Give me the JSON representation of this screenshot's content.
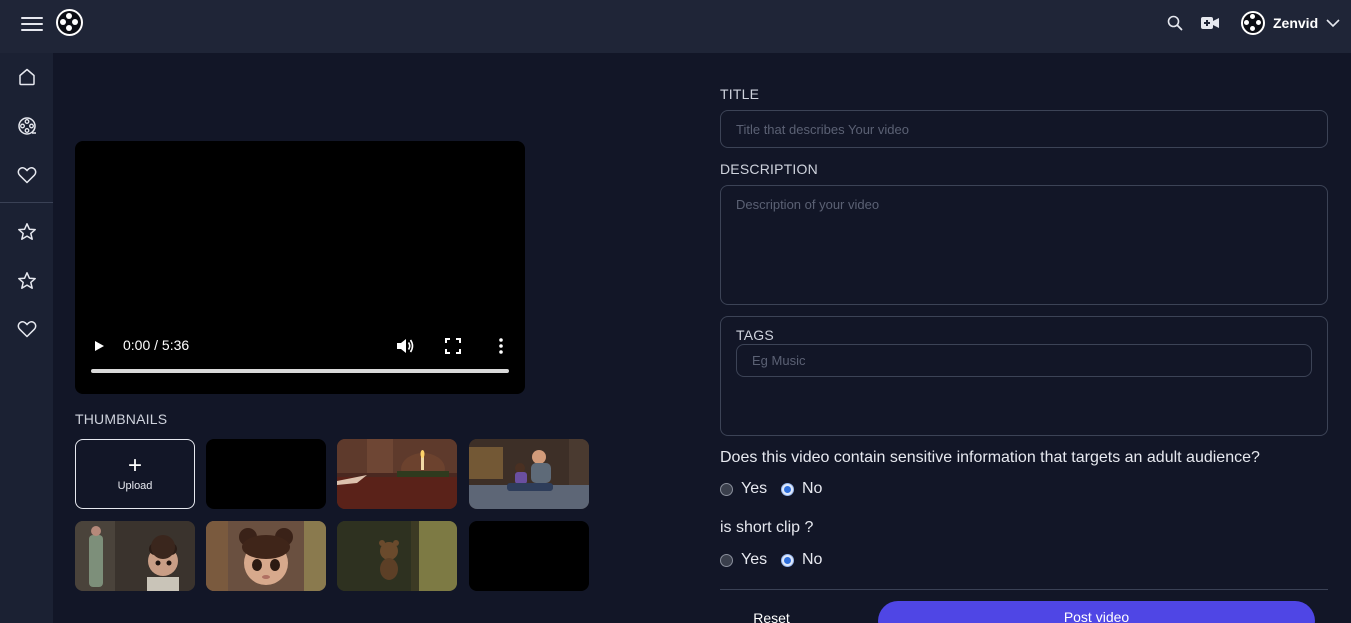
{
  "header": {
    "user_name": "Zenvid",
    "icons": [
      "menu-icon",
      "logo",
      "search-icon",
      "video-add-icon",
      "chevron-down-icon"
    ]
  },
  "sidebar": {
    "items": [
      {
        "icon": "home-icon"
      },
      {
        "icon": "film-reel-icon"
      },
      {
        "icon": "heart-icon"
      },
      {
        "icon": "star-icon"
      },
      {
        "icon": "star-icon"
      },
      {
        "icon": "heart-icon"
      }
    ]
  },
  "player": {
    "time": "0:00 / 5:36",
    "progress": 0
  },
  "thumbnails": {
    "label": "THUMBNAILS",
    "upload_label": "Upload",
    "upload_symbol": "+"
  },
  "form": {
    "title_label": "TITLE",
    "title_placeholder": "Title that describes Your video",
    "description_label": "DESCRIPTION",
    "description_placeholder": "Description of your video",
    "tags_label": "TAGS",
    "tags_placeholder": "Eg Music",
    "adult_question": "Does this video contain sensitive information that targets an adult audience?",
    "adult_yes": "Yes",
    "adult_no": "No",
    "adult_selected": "No",
    "short_question": "is short clip ?",
    "short_yes": "Yes",
    "short_no": "No",
    "short_selected": "No",
    "reset_label": "Reset",
    "post_label": "Post video"
  },
  "colors": {
    "background": "#121627",
    "topbar": "#1f2537",
    "sidebar": "#1b2133",
    "accent": "#4f46e5"
  }
}
